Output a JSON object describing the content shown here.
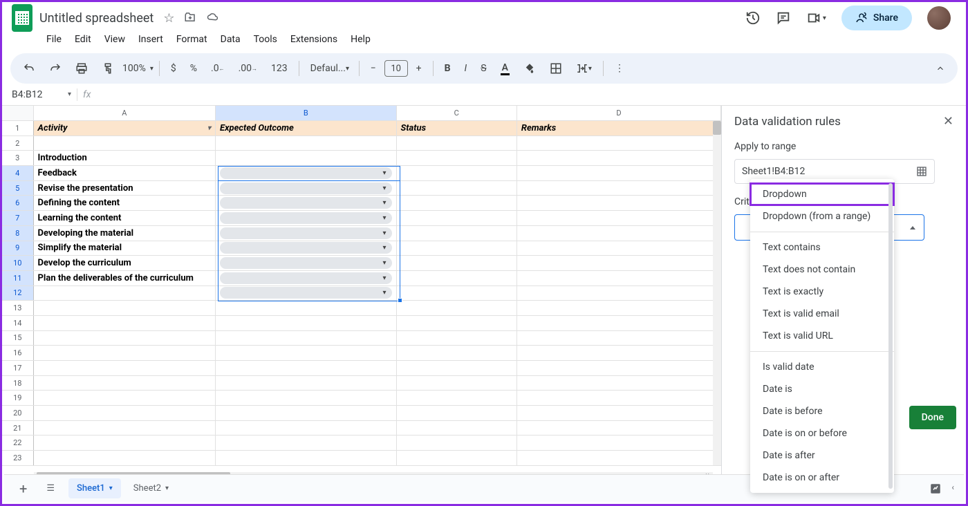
{
  "title": "Untitled spreadsheet",
  "menu": [
    "File",
    "Edit",
    "View",
    "Insert",
    "Format",
    "Data",
    "Tools",
    "Extensions",
    "Help"
  ],
  "share": "Share",
  "toolbar": {
    "zoom": "100%",
    "font": "Defaul...",
    "size": "10",
    "format_number": "123"
  },
  "namebox": "B4:B12",
  "columns": [
    "A",
    "B",
    "C",
    "D"
  ],
  "header_row": {
    "A": "Activity",
    "B": "Expected Outcome",
    "C": "Status",
    "D": "Remarks"
  },
  "rows": [
    {
      "n": 1,
      "hdr": true
    },
    {
      "n": 2
    },
    {
      "n": 3,
      "A": "Introduction"
    },
    {
      "n": 4,
      "A": "Feedback",
      "chip": true,
      "selTop": true
    },
    {
      "n": 5,
      "A": "Revise the presentation",
      "chip": true
    },
    {
      "n": 6,
      "A": "Defining the content",
      "chip": true
    },
    {
      "n": 7,
      "A": "Learning the content",
      "chip": true
    },
    {
      "n": 8,
      "A": "Developing the material",
      "chip": true
    },
    {
      "n": 9,
      "A": "Simplify the material",
      "chip": true
    },
    {
      "n": 10,
      "A": "Develop the curriculum",
      "chip": true
    },
    {
      "n": 11,
      "A": "Plan the deliverables of the curriculum",
      "chip": true
    },
    {
      "n": 12,
      "chip": true,
      "selBot": true
    },
    {
      "n": 13
    },
    {
      "n": 14
    },
    {
      "n": 15
    },
    {
      "n": 16
    },
    {
      "n": 17
    },
    {
      "n": 18
    },
    {
      "n": 19
    },
    {
      "n": 20
    },
    {
      "n": 21
    },
    {
      "n": 22
    },
    {
      "n": 23
    }
  ],
  "panel": {
    "title": "Data validation rules",
    "apply_label": "Apply to range",
    "range": "Sheet1!B4:B12",
    "criteria_label": "Criteria",
    "done": "Done"
  },
  "criteria_options": [
    {
      "label": "Dropdown",
      "hl": true
    },
    {
      "label": "Dropdown (from a range)"
    },
    {
      "sep": true
    },
    {
      "label": "Text contains"
    },
    {
      "label": "Text does not contain"
    },
    {
      "label": "Text is exactly"
    },
    {
      "label": "Text is valid email"
    },
    {
      "label": "Text is valid URL"
    },
    {
      "sep": true
    },
    {
      "label": "Is valid date"
    },
    {
      "label": "Date is"
    },
    {
      "label": "Date is before"
    },
    {
      "label": "Date is on or before"
    },
    {
      "label": "Date is after"
    },
    {
      "label": "Date is on or after"
    }
  ],
  "tabs": [
    {
      "name": "Sheet1",
      "active": true
    },
    {
      "name": "Sheet2",
      "active": false
    }
  ]
}
